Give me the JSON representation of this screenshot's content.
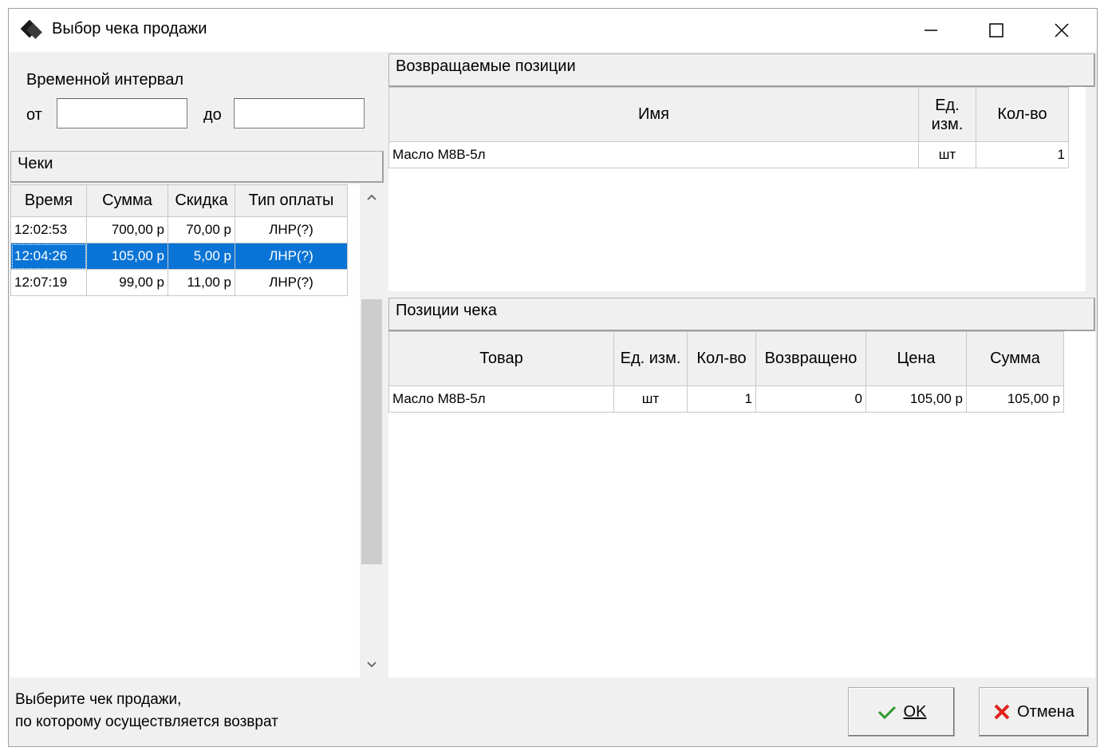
{
  "window": {
    "title": "Выбор чека продажи",
    "minimize_glyph": "—",
    "maximize_glyph": "☐",
    "close_glyph": "✕"
  },
  "interval": {
    "label": "Временной интервал",
    "from_label": "от",
    "to_label": "до",
    "from_value": "",
    "to_value": ""
  },
  "receipts": {
    "header": "Чеки",
    "columns": [
      "Время",
      "Сумма",
      "Скидка",
      "Тип оплаты"
    ],
    "rows": [
      {
        "time": "12:02:53",
        "sum": "700,00 р",
        "discount": "70,00 р",
        "payment": "ЛНР(?)"
      },
      {
        "time": "12:04:26",
        "sum": "105,00 р",
        "discount": "5,00 р",
        "payment": "ЛНР(?)"
      },
      {
        "time": "12:07:19",
        "sum": "99,00 р",
        "discount": "11,00 р",
        "payment": "ЛНР(?)"
      }
    ],
    "selected_index": 1
  },
  "returned": {
    "header": "Возвращаемые позиции",
    "col_name": "Имя",
    "col_unit_line1": "Ед.",
    "col_unit_line2": "изм.",
    "col_qty": "Кол-во",
    "rows": [
      {
        "name": "Масло М8В-5л",
        "unit": "шт",
        "qty": "1"
      }
    ]
  },
  "positions": {
    "header": "Позиции чека",
    "columns": [
      "Товар",
      "Ед. изм.",
      "Кол-во",
      "Возвращено",
      "Цена",
      "Сумма"
    ],
    "rows": [
      {
        "product": "Масло М8В-5л",
        "unit": "шт",
        "qty": "1",
        "returned": "0",
        "price": "105,00 р",
        "sum": "105,00 р"
      }
    ]
  },
  "status": {
    "line1": "Выберите чек продажи,",
    "line2": "по которому осуществляется возврат"
  },
  "buttons": {
    "ok_label": "OK",
    "cancel_label": "Отмена"
  },
  "colors": {
    "selection": "#0a74d6",
    "ok_check": "#2e9b2e",
    "cancel_x": "#e0221b"
  }
}
